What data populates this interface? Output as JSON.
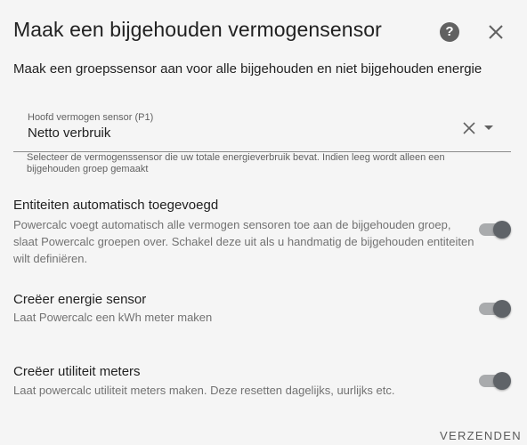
{
  "dialog": {
    "title": "Maak een bijgehouden vermogensensor",
    "help_icon": "question-circle-icon",
    "close_icon": "close-icon",
    "intro": "Maak een groepssensor aan voor alle bijgehouden en niet bijgehouden energie"
  },
  "main_sensor": {
    "label": "Hoofd vermogen sensor (P1)",
    "value": "Netto verbruik",
    "helper": "Selecteer de vermogenssensor die uw totale energieverbruik bevat. Indien leeg wordt alleen een bijgehouden groep gemaakt"
  },
  "settings": [
    {
      "title": "Entiteiten automatisch toegevoegd",
      "description": "Powercalc voegt automatisch alle vermogen sensoren toe aan de bijgehouden groep, slaat Powercalc groepen over. Schakel deze uit als u handmatig de bijgehouden entiteiten wilt definiëren.",
      "enabled": true
    },
    {
      "title": "Creëer energie sensor",
      "description": "Laat Powercalc een kWh meter maken",
      "enabled": true
    },
    {
      "title": "Creëer utiliteit meters",
      "description": "Laat powercalc utiliteit meters maken. Deze resetten dagelijks, uurlijks etc.",
      "enabled": true
    }
  ],
  "actions": {
    "submit_label": "VERZENDEN"
  },
  "colors": {
    "background": "#f5f5f5",
    "text_primary": "#212121",
    "text_secondary": "#727272",
    "toggle_thumb": "#5f6368",
    "toggle_track": "#a9abad"
  }
}
